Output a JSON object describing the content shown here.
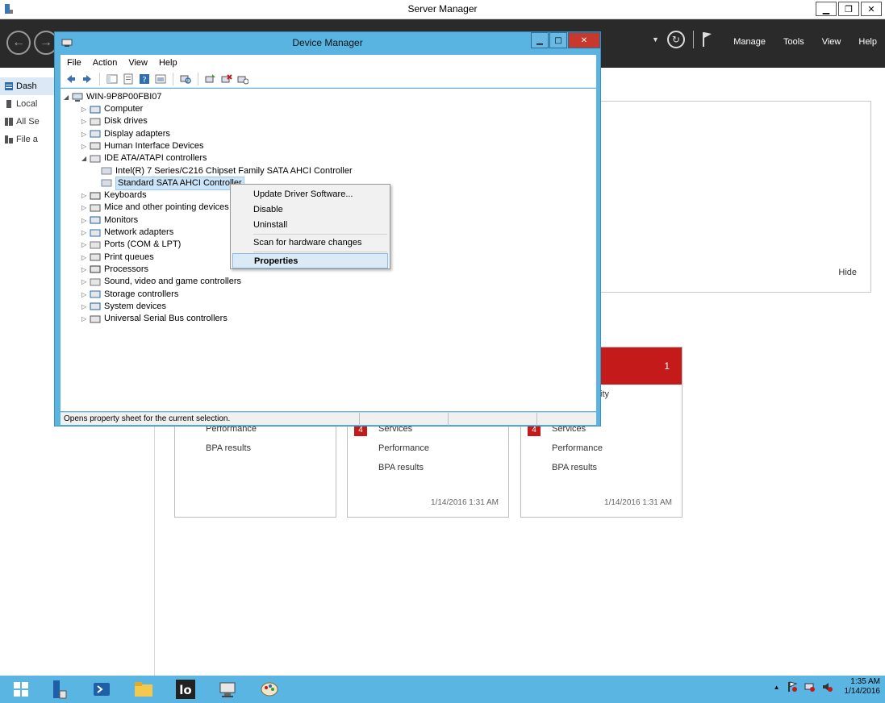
{
  "server_manager": {
    "title": "Server Manager",
    "menu": [
      "Manage",
      "Tools",
      "View",
      "Help"
    ],
    "sidebar": [
      {
        "label": "Dashboard",
        "visible": "Dash",
        "active": true
      },
      {
        "label": "Local Server",
        "visible": "Local"
      },
      {
        "label": "All Servers",
        "visible": "All Se"
      },
      {
        "label": "File and Storage Services",
        "visible": "File a"
      }
    ],
    "welcome_hide": "Hide",
    "tiles": [
      {
        "rows": [
          "Performance",
          "BPA results"
        ]
      },
      {
        "badge": "4",
        "rows": [
          "Services",
          "Performance",
          "BPA results"
        ],
        "timestamp": "1/14/2016 1:31 AM"
      },
      {
        "count": "1",
        "partial": "ity",
        "badge": "4",
        "rows": [
          "Services",
          "Performance",
          "BPA results"
        ],
        "timestamp": "1/14/2016 1:31 AM"
      }
    ]
  },
  "device_manager": {
    "title": "Device Manager",
    "menu": [
      "File",
      "Action",
      "View",
      "Help"
    ],
    "tree": {
      "root": "WIN-9P8P00FBI07",
      "nodes": [
        {
          "label": "Computer",
          "expanded": false
        },
        {
          "label": "Disk drives",
          "expanded": false
        },
        {
          "label": "Display adapters",
          "expanded": false
        },
        {
          "label": "Human Interface Devices",
          "expanded": false
        },
        {
          "label": "IDE ATA/ATAPI controllers",
          "expanded": true
        },
        {
          "label": "Intel(R) 7 Series/C216 Chipset Family SATA AHCI Controller",
          "child": true
        },
        {
          "label": "Standard SATA AHCI Controller",
          "child": true,
          "selected": true
        },
        {
          "label": "Keyboards",
          "expanded": false
        },
        {
          "label": "Mice and other pointing devices",
          "expanded": false
        },
        {
          "label": "Monitors",
          "expanded": false
        },
        {
          "label": "Network adapters",
          "expanded": false
        },
        {
          "label": "Ports (COM & LPT)",
          "expanded": false
        },
        {
          "label": "Print queues",
          "expanded": false
        },
        {
          "label": "Processors",
          "expanded": false
        },
        {
          "label": "Sound, video and game controllers",
          "expanded": false
        },
        {
          "label": "Storage controllers",
          "expanded": false
        },
        {
          "label": "System devices",
          "expanded": false
        },
        {
          "label": "Universal Serial Bus controllers",
          "expanded": false
        }
      ]
    },
    "context_menu": [
      "Update Driver Software...",
      "Disable",
      "Uninstall",
      "Scan for hardware changes",
      "Properties"
    ],
    "status": "Opens property sheet for the current selection."
  },
  "taskbar": {
    "apps": [
      "start",
      "server-manager",
      "powershell",
      "file-explorer",
      "libreoffice",
      "device-manager",
      "paint"
    ],
    "clock_time": "1:35 AM",
    "clock_date": "1/14/2016"
  },
  "colors": {
    "accent": "#5ab5e2",
    "alert": "#c41a1a",
    "dark_header": "#2a2a2a"
  }
}
